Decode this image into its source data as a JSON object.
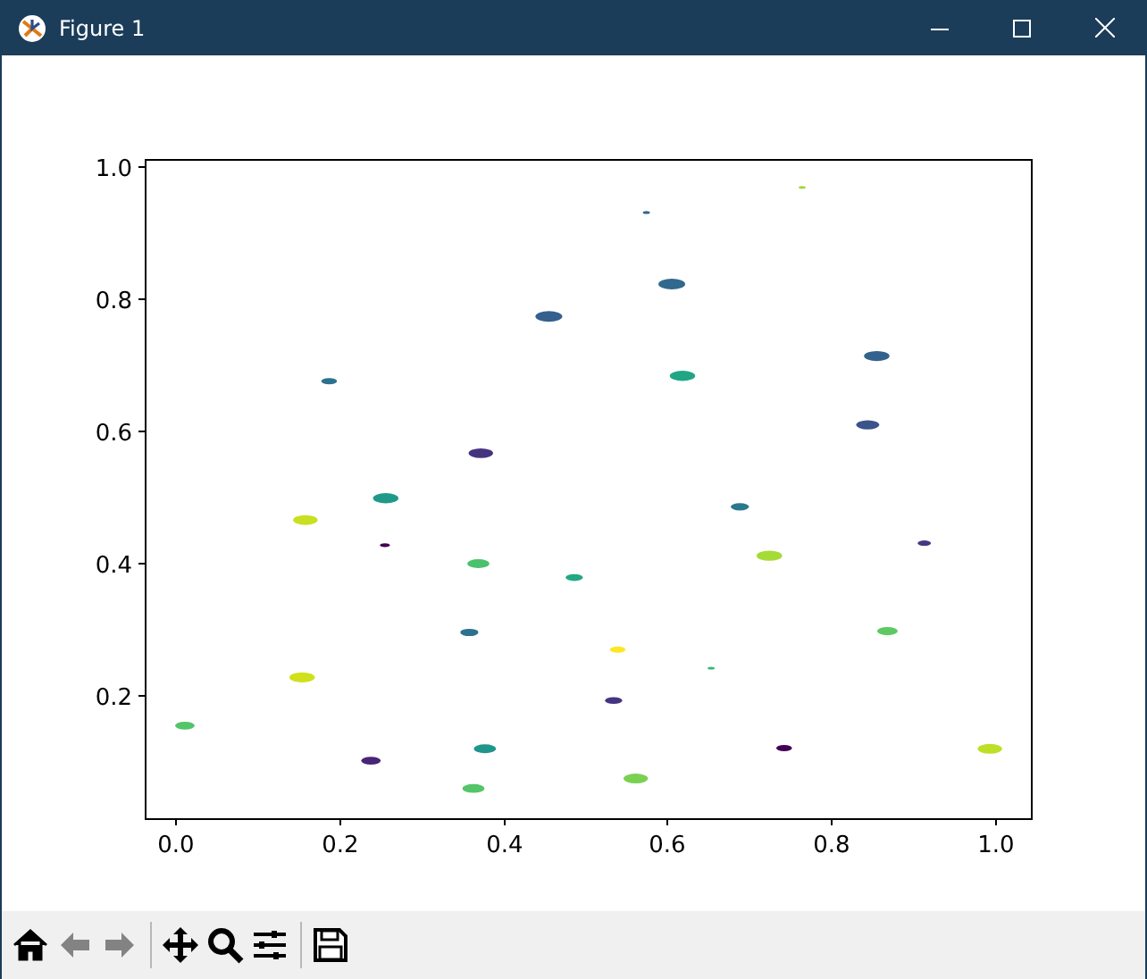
{
  "window": {
    "title": "Figure 1"
  },
  "figure": {
    "chart_data": {
      "type": "scatter",
      "xlim": [
        -0.037,
        1.044
      ],
      "ylim": [
        0.014,
        1.011
      ],
      "xticks": [
        {
          "value": 0,
          "label": "0.0"
        },
        {
          "value": 0.2,
          "label": "0.2"
        },
        {
          "value": 0.4,
          "label": "0.4"
        },
        {
          "value": 0.6,
          "label": "0.6"
        },
        {
          "value": 0.8,
          "label": "0.8"
        },
        {
          "value": 1,
          "label": "1.0"
        }
      ],
      "yticks": [
        {
          "value": 0.2,
          "label": "0.2"
        },
        {
          "value": 0.4,
          "label": "0.4"
        },
        {
          "value": 0.6,
          "label": "0.6"
        },
        {
          "value": 0.8,
          "label": "0.8"
        },
        {
          "value": 1,
          "label": "1.0"
        }
      ],
      "x": [
        0.765,
        0.575,
        0.606,
        0.456,
        0.856,
        0.188,
        0.619,
        0.845,
        0.373,
        0.257,
        0.689,
        0.159,
        0.256,
        0.914,
        0.725,
        0.37,
        0.487,
        0.359,
        0.869,
        0.54,
        0.654,
        0.155,
        0.535,
        0.012,
        0.378,
        0.743,
        0.994,
        0.239,
        0.562,
        0.364
      ],
      "series": [
        {
          "color": "#a0da39",
          "values": [
            0.968,
            null,
            null,
            null,
            null,
            null,
            null,
            null,
            null,
            null,
            null,
            null,
            null,
            null,
            null,
            null,
            null,
            null,
            null,
            null,
            null,
            null,
            null,
            null,
            null,
            null,
            null,
            null,
            null,
            null
          ],
          "sizes": [
            0.07,
            null,
            null,
            null,
            null,
            null,
            null,
            null,
            null,
            null,
            null,
            null,
            null,
            null,
            null,
            null,
            null,
            null,
            null,
            null,
            null,
            null,
            null,
            null,
            null,
            null,
            null,
            null,
            null,
            null
          ]
        },
        {
          "color": "#31688e",
          "values": [
            null,
            0.93,
            null,
            null,
            null,
            null,
            null,
            null,
            null,
            null,
            null,
            null,
            null,
            null,
            null,
            null,
            null,
            null,
            null,
            null,
            null,
            null,
            null,
            null,
            null,
            null,
            null,
            null,
            null,
            null
          ],
          "sizes": [
            null,
            0.07,
            null,
            null,
            null,
            null,
            null,
            null,
            null,
            null,
            null,
            null,
            null,
            null,
            null,
            null,
            null,
            null,
            null,
            null,
            null,
            null,
            null,
            null,
            null,
            null,
            null,
            null,
            null,
            null
          ]
        },
        {
          "color": "#31688e",
          "values": [
            null,
            null,
            0.822,
            null,
            null,
            null,
            null,
            null,
            null,
            null,
            null,
            null,
            null,
            null,
            null,
            null,
            null,
            null,
            null,
            null,
            null,
            null,
            null,
            null,
            null,
            null,
            null,
            null,
            null,
            null
          ],
          "sizes": [
            null,
            null,
            1,
            null,
            null,
            null,
            null,
            null,
            null,
            null,
            null,
            null,
            null,
            null,
            null,
            null,
            null,
            null,
            null,
            null,
            null,
            null,
            null,
            null,
            null,
            null,
            null,
            null,
            null,
            null
          ]
        },
        {
          "color": "#355f8d",
          "values": [
            null,
            null,
            null,
            0.773,
            null,
            null,
            null,
            null,
            null,
            null,
            null,
            null,
            null,
            null,
            null,
            null,
            null,
            null,
            null,
            null,
            null,
            null,
            null,
            null,
            null,
            null,
            null,
            null,
            null,
            null
          ],
          "sizes": [
            null,
            null,
            null,
            1,
            null,
            null,
            null,
            null,
            null,
            null,
            null,
            null,
            null,
            null,
            null,
            null,
            null,
            null,
            null,
            null,
            null,
            null,
            null,
            null,
            null,
            null,
            null,
            null,
            null,
            null
          ]
        },
        {
          "color": "#33638d",
          "values": [
            null,
            null,
            null,
            null,
            0.713,
            null,
            null,
            null,
            null,
            null,
            null,
            null,
            null,
            null,
            null,
            null,
            null,
            null,
            null,
            null,
            null,
            null,
            null,
            null,
            null,
            null,
            null,
            null,
            null,
            null
          ],
          "sizes": [
            null,
            null,
            null,
            null,
            0.9,
            null,
            null,
            null,
            null,
            null,
            null,
            null,
            null,
            null,
            null,
            null,
            null,
            null,
            null,
            null,
            null,
            null,
            null,
            null,
            null,
            null,
            null,
            null,
            null,
            null
          ]
        },
        {
          "color": "#2c728e",
          "values": [
            null,
            null,
            null,
            null,
            null,
            0.675,
            null,
            null,
            null,
            null,
            null,
            null,
            null,
            null,
            null,
            null,
            null,
            null,
            null,
            null,
            null,
            null,
            null,
            null,
            null,
            null,
            null,
            null,
            null,
            null
          ],
          "sizes": [
            null,
            null,
            null,
            null,
            null,
            0.35,
            null,
            null,
            null,
            null,
            null,
            null,
            null,
            null,
            null,
            null,
            null,
            null,
            null,
            null,
            null,
            null,
            null,
            null,
            null,
            null,
            null,
            null,
            null,
            null
          ]
        },
        {
          "color": "#21a685",
          "values": [
            null,
            null,
            null,
            null,
            null,
            null,
            0.683,
            null,
            null,
            null,
            null,
            null,
            null,
            null,
            null,
            null,
            null,
            null,
            null,
            null,
            null,
            null,
            null,
            null,
            null,
            null,
            null,
            null,
            null,
            null
          ],
          "sizes": [
            null,
            null,
            null,
            null,
            null,
            null,
            0.9,
            null,
            null,
            null,
            null,
            null,
            null,
            null,
            null,
            null,
            null,
            null,
            null,
            null,
            null,
            null,
            null,
            null,
            null,
            null,
            null,
            null,
            null,
            null
          ]
        },
        {
          "color": "#3b528b",
          "values": [
            null,
            null,
            null,
            null,
            null,
            null,
            null,
            0.609,
            null,
            null,
            null,
            null,
            null,
            null,
            null,
            null,
            null,
            null,
            null,
            null,
            null,
            null,
            null,
            null,
            null,
            null,
            null,
            null,
            null,
            null
          ],
          "sizes": [
            null,
            null,
            null,
            null,
            null,
            null,
            null,
            0.74,
            null,
            null,
            null,
            null,
            null,
            null,
            null,
            null,
            null,
            null,
            null,
            null,
            null,
            null,
            null,
            null,
            null,
            null,
            null,
            null,
            null,
            null
          ]
        },
        {
          "color": "#46337f",
          "values": [
            null,
            null,
            null,
            null,
            null,
            null,
            null,
            null,
            0.566,
            null,
            null,
            null,
            null,
            null,
            null,
            null,
            null,
            null,
            null,
            null,
            null,
            null,
            null,
            null,
            null,
            null,
            null,
            null,
            null,
            null
          ],
          "sizes": [
            null,
            null,
            null,
            null,
            null,
            null,
            null,
            null,
            0.83,
            null,
            null,
            null,
            null,
            null,
            null,
            null,
            null,
            null,
            null,
            null,
            null,
            null,
            null,
            null,
            null,
            null,
            null,
            null,
            null,
            null
          ]
        },
        {
          "color": "#1f9a8a",
          "values": [
            null,
            null,
            null,
            null,
            null,
            null,
            null,
            null,
            null,
            0.498,
            null,
            null,
            null,
            null,
            null,
            null,
            null,
            null,
            null,
            null,
            null,
            null,
            null,
            null,
            null,
            null,
            null,
            null,
            null,
            null
          ],
          "sizes": [
            null,
            null,
            null,
            null,
            null,
            null,
            null,
            null,
            null,
            0.9,
            null,
            null,
            null,
            null,
            null,
            null,
            null,
            null,
            null,
            null,
            null,
            null,
            null,
            null,
            null,
            null,
            null,
            null,
            null,
            null
          ]
        },
        {
          "color": "#2a788e",
          "values": [
            null,
            null,
            null,
            null,
            null,
            null,
            null,
            null,
            null,
            null,
            0.485,
            null,
            null,
            null,
            null,
            null,
            null,
            null,
            null,
            null,
            null,
            null,
            null,
            null,
            null,
            null,
            null,
            null,
            null,
            null
          ],
          "sizes": [
            null,
            null,
            null,
            null,
            null,
            null,
            null,
            null,
            null,
            null,
            0.46,
            null,
            null,
            null,
            null,
            null,
            null,
            null,
            null,
            null,
            null,
            null,
            null,
            null,
            null,
            null,
            null,
            null,
            null,
            null
          ]
        },
        {
          "color": "#c8e020",
          "values": [
            null,
            null,
            null,
            null,
            null,
            null,
            null,
            null,
            null,
            null,
            null,
            0.465,
            null,
            null,
            null,
            null,
            null,
            null,
            null,
            null,
            null,
            null,
            null,
            null,
            null,
            null,
            null,
            null,
            null,
            null
          ],
          "sizes": [
            null,
            null,
            null,
            null,
            null,
            null,
            null,
            null,
            null,
            null,
            null,
            0.83,
            null,
            null,
            null,
            null,
            null,
            null,
            null,
            null,
            null,
            null,
            null,
            null,
            null,
            null,
            null,
            null,
            null,
            null
          ]
        },
        {
          "color": "#440154",
          "values": [
            null,
            null,
            null,
            null,
            null,
            null,
            null,
            null,
            null,
            null,
            null,
            null,
            0.427,
            null,
            null,
            null,
            null,
            null,
            null,
            null,
            null,
            null,
            null,
            null,
            null,
            null,
            null,
            null,
            null,
            null
          ],
          "sizes": [
            null,
            null,
            null,
            null,
            null,
            null,
            null,
            null,
            null,
            null,
            null,
            null,
            0.13,
            null,
            null,
            null,
            null,
            null,
            null,
            null,
            null,
            null,
            null,
            null,
            null,
            null,
            null,
            null,
            null,
            null
          ]
        },
        {
          "color": "#443983",
          "values": [
            null,
            null,
            null,
            null,
            null,
            null,
            null,
            null,
            null,
            null,
            null,
            null,
            null,
            0.43,
            null,
            null,
            null,
            null,
            null,
            null,
            null,
            null,
            null,
            null,
            null,
            null,
            null,
            null,
            null,
            null
          ],
          "sizes": [
            null,
            null,
            null,
            null,
            null,
            null,
            null,
            null,
            null,
            null,
            null,
            null,
            null,
            0.25,
            null,
            null,
            null,
            null,
            null,
            null,
            null,
            null,
            null,
            null,
            null,
            null,
            null,
            null,
            null,
            null
          ]
        },
        {
          "color": "#a5db36",
          "values": [
            null,
            null,
            null,
            null,
            null,
            null,
            null,
            null,
            null,
            null,
            null,
            null,
            null,
            null,
            0.411,
            null,
            null,
            null,
            null,
            null,
            null,
            null,
            null,
            null,
            null,
            null,
            null,
            null,
            null,
            null
          ],
          "sizes": [
            null,
            null,
            null,
            null,
            null,
            null,
            null,
            null,
            null,
            null,
            null,
            null,
            null,
            null,
            0.9,
            null,
            null,
            null,
            null,
            null,
            null,
            null,
            null,
            null,
            null,
            null,
            null,
            null,
            null,
            null
          ]
        },
        {
          "color": "#4ac16d",
          "values": [
            null,
            null,
            null,
            null,
            null,
            null,
            null,
            null,
            null,
            null,
            null,
            null,
            null,
            null,
            null,
            0.399,
            null,
            null,
            null,
            null,
            null,
            null,
            null,
            null,
            null,
            null,
            null,
            null,
            null,
            null
          ],
          "sizes": [
            null,
            null,
            null,
            null,
            null,
            null,
            null,
            null,
            null,
            null,
            null,
            null,
            null,
            null,
            null,
            0.67,
            null,
            null,
            null,
            null,
            null,
            null,
            null,
            null,
            null,
            null,
            null,
            null,
            null,
            null
          ]
        },
        {
          "color": "#22a884",
          "values": [
            null,
            null,
            null,
            null,
            null,
            null,
            null,
            null,
            null,
            null,
            null,
            null,
            null,
            null,
            null,
            null,
            0.378,
            null,
            null,
            null,
            null,
            null,
            null,
            null,
            null,
            null,
            null,
            null,
            null,
            null
          ],
          "sizes": [
            null,
            null,
            null,
            null,
            null,
            null,
            null,
            null,
            null,
            null,
            null,
            null,
            null,
            null,
            null,
            null,
            0.41,
            null,
            null,
            null,
            null,
            null,
            null,
            null,
            null,
            null,
            null,
            null,
            null,
            null
          ]
        },
        {
          "color": "#2c728e",
          "values": [
            null,
            null,
            null,
            null,
            null,
            null,
            null,
            null,
            null,
            null,
            null,
            null,
            null,
            null,
            null,
            null,
            null,
            0.295,
            null,
            null,
            null,
            null,
            null,
            null,
            null,
            null,
            null,
            null,
            null,
            null
          ],
          "sizes": [
            null,
            null,
            null,
            null,
            null,
            null,
            null,
            null,
            null,
            null,
            null,
            null,
            null,
            null,
            null,
            null,
            null,
            0.46,
            null,
            null,
            null,
            null,
            null,
            null,
            null,
            null,
            null,
            null,
            null,
            null
          ]
        },
        {
          "color": "#5ec962",
          "values": [
            null,
            null,
            null,
            null,
            null,
            null,
            null,
            null,
            null,
            null,
            null,
            null,
            null,
            null,
            null,
            null,
            null,
            null,
            0.297,
            null,
            null,
            null,
            null,
            null,
            null,
            null,
            null,
            null,
            null,
            null
          ],
          "sizes": [
            null,
            null,
            null,
            null,
            null,
            null,
            null,
            null,
            null,
            null,
            null,
            null,
            null,
            null,
            null,
            null,
            null,
            null,
            0.59,
            null,
            null,
            null,
            null,
            null,
            null,
            null,
            null,
            null,
            null,
            null
          ]
        },
        {
          "color": "#fde725",
          "values": [
            null,
            null,
            null,
            null,
            null,
            null,
            null,
            null,
            null,
            null,
            null,
            null,
            null,
            null,
            null,
            null,
            null,
            null,
            null,
            0.269,
            null,
            null,
            null,
            null,
            null,
            null,
            null,
            null,
            null,
            null
          ],
          "sizes": [
            null,
            null,
            null,
            null,
            null,
            null,
            null,
            null,
            null,
            null,
            null,
            null,
            null,
            null,
            null,
            null,
            null,
            null,
            null,
            0.35,
            null,
            null,
            null,
            null,
            null,
            null,
            null,
            null,
            null,
            null
          ]
        },
        {
          "color": "#35b779",
          "values": [
            null,
            null,
            null,
            null,
            null,
            null,
            null,
            null,
            null,
            null,
            null,
            null,
            null,
            null,
            null,
            null,
            null,
            null,
            null,
            null,
            0.241,
            null,
            null,
            null,
            null,
            null,
            null,
            null,
            null,
            null
          ],
          "sizes": [
            null,
            null,
            null,
            null,
            null,
            null,
            null,
            null,
            null,
            null,
            null,
            null,
            null,
            null,
            null,
            null,
            null,
            null,
            null,
            null,
            0.07,
            null,
            null,
            null,
            null,
            null,
            null,
            null,
            null,
            null
          ]
        },
        {
          "color": "#d0e11c",
          "values": [
            null,
            null,
            null,
            null,
            null,
            null,
            null,
            null,
            null,
            null,
            null,
            null,
            null,
            null,
            null,
            null,
            null,
            null,
            null,
            null,
            null,
            0.227,
            null,
            null,
            null,
            null,
            null,
            null,
            null,
            null
          ],
          "sizes": [
            null,
            null,
            null,
            null,
            null,
            null,
            null,
            null,
            null,
            null,
            null,
            null,
            null,
            null,
            null,
            null,
            null,
            null,
            null,
            null,
            null,
            0.9,
            null,
            null,
            null,
            null,
            null,
            null,
            null,
            null
          ]
        },
        {
          "color": "#463480",
          "values": [
            null,
            null,
            null,
            null,
            null,
            null,
            null,
            null,
            null,
            null,
            null,
            null,
            null,
            null,
            null,
            null,
            null,
            null,
            null,
            null,
            null,
            null,
            0.192,
            null,
            null,
            null,
            null,
            null,
            null,
            null
          ],
          "sizes": [
            null,
            null,
            null,
            null,
            null,
            null,
            null,
            null,
            null,
            null,
            null,
            null,
            null,
            null,
            null,
            null,
            null,
            null,
            null,
            null,
            null,
            null,
            0.41,
            null,
            null,
            null,
            null,
            null,
            null,
            null
          ]
        },
        {
          "color": "#52c569",
          "values": [
            null,
            null,
            null,
            null,
            null,
            null,
            null,
            null,
            null,
            null,
            null,
            null,
            null,
            null,
            null,
            null,
            null,
            null,
            null,
            null,
            null,
            null,
            null,
            0.154,
            null,
            null,
            null,
            null,
            null,
            null
          ],
          "sizes": [
            null,
            null,
            null,
            null,
            null,
            null,
            null,
            null,
            null,
            null,
            null,
            null,
            null,
            null,
            null,
            null,
            null,
            null,
            null,
            null,
            null,
            null,
            null,
            0.53,
            null,
            null,
            null,
            null,
            null,
            null
          ]
        },
        {
          "color": "#1f968b",
          "values": [
            null,
            null,
            null,
            null,
            null,
            null,
            null,
            null,
            null,
            null,
            null,
            null,
            null,
            null,
            null,
            null,
            null,
            null,
            null,
            null,
            null,
            null,
            null,
            null,
            0.119,
            null,
            null,
            null,
            null,
            null
          ],
          "sizes": [
            null,
            null,
            null,
            null,
            null,
            null,
            null,
            null,
            null,
            null,
            null,
            null,
            null,
            null,
            null,
            null,
            null,
            null,
            null,
            null,
            null,
            null,
            null,
            null,
            0.67,
            null,
            null,
            null,
            null,
            null
          ]
        },
        {
          "color": "#440154",
          "values": [
            null,
            null,
            null,
            null,
            null,
            null,
            null,
            null,
            null,
            null,
            null,
            null,
            null,
            null,
            null,
            null,
            null,
            null,
            null,
            null,
            null,
            null,
            null,
            null,
            null,
            0.12,
            null,
            null,
            null,
            null
          ],
          "sizes": [
            null,
            null,
            null,
            null,
            null,
            null,
            null,
            null,
            null,
            null,
            null,
            null,
            null,
            null,
            null,
            null,
            null,
            null,
            null,
            null,
            null,
            null,
            null,
            null,
            null,
            0.35,
            null,
            null,
            null,
            null
          ]
        },
        {
          "color": "#bddf26",
          "values": [
            null,
            null,
            null,
            null,
            null,
            null,
            null,
            null,
            null,
            null,
            null,
            null,
            null,
            null,
            null,
            null,
            null,
            null,
            null,
            null,
            null,
            null,
            null,
            null,
            null,
            null,
            0.119,
            null,
            null,
            null
          ],
          "sizes": [
            null,
            null,
            null,
            null,
            null,
            null,
            null,
            null,
            null,
            null,
            null,
            null,
            null,
            null,
            null,
            null,
            null,
            null,
            null,
            null,
            null,
            null,
            null,
            null,
            null,
            null,
            0.83,
            null,
            null,
            null
          ]
        },
        {
          "color": "#482576",
          "values": [
            null,
            null,
            null,
            null,
            null,
            null,
            null,
            null,
            null,
            null,
            null,
            null,
            null,
            null,
            null,
            null,
            null,
            null,
            null,
            null,
            null,
            null,
            null,
            null,
            null,
            null,
            null,
            0.101,
            null,
            null
          ],
          "sizes": [
            null,
            null,
            null,
            null,
            null,
            null,
            null,
            null,
            null,
            null,
            null,
            null,
            null,
            null,
            null,
            null,
            null,
            null,
            null,
            null,
            null,
            null,
            null,
            null,
            null,
            null,
            null,
            0.53,
            null,
            null
          ]
        },
        {
          "color": "#7ad151",
          "values": [
            null,
            null,
            null,
            null,
            null,
            null,
            null,
            null,
            null,
            null,
            null,
            null,
            null,
            null,
            null,
            null,
            null,
            null,
            null,
            null,
            null,
            null,
            null,
            null,
            null,
            null,
            null,
            null,
            0.074,
            null
          ],
          "sizes": [
            null,
            null,
            null,
            null,
            null,
            null,
            null,
            null,
            null,
            null,
            null,
            null,
            null,
            null,
            null,
            null,
            null,
            null,
            null,
            null,
            null,
            null,
            null,
            null,
            null,
            null,
            null,
            null,
            0.83,
            null
          ]
        },
        {
          "color": "#54c568",
          "values": [
            null,
            null,
            null,
            null,
            null,
            null,
            null,
            null,
            null,
            null,
            null,
            null,
            null,
            null,
            null,
            null,
            null,
            null,
            null,
            null,
            null,
            null,
            null,
            null,
            null,
            null,
            null,
            null,
            null,
            0.059
          ],
          "sizes": [
            null,
            null,
            null,
            null,
            null,
            null,
            null,
            null,
            null,
            null,
            null,
            null,
            null,
            null,
            null,
            null,
            null,
            null,
            null,
            null,
            null,
            null,
            null,
            null,
            null,
            null,
            null,
            null,
            null,
            0.67
          ]
        }
      ]
    }
  },
  "toolbar": [
    {
      "disabled": false
    },
    {
      "disabled": true
    },
    {
      "disabled": true
    },
    {
      "disabled": false
    },
    {
      "disabled": false
    },
    {
      "disabled": false
    },
    {
      "disabled": false
    }
  ]
}
